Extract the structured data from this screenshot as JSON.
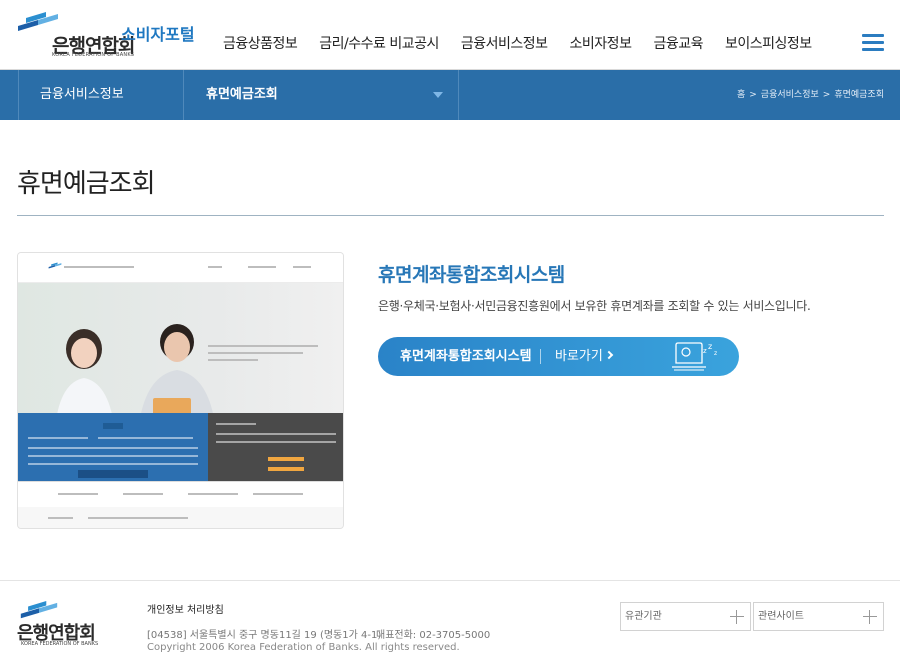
{
  "header": {
    "logo_text": "은행연합회",
    "logo_sub": "KOREA FEDERATION OF BANKS",
    "portal": "소비자포털",
    "nav": [
      "금융상품정보",
      "금리/수수료 비교공시",
      "금융서비스정보",
      "소비자정보",
      "금융교육",
      "보이스피싱정보"
    ],
    "menu_icon": "hamburger-icon"
  },
  "locbar": {
    "section": "금융서비스정보",
    "current": "휴면예금조회",
    "breadcrumb": [
      "홈",
      "금융서비스정보",
      "휴면예금조회"
    ]
  },
  "page": {
    "title": "휴면예금조회"
  },
  "service": {
    "title": "휴면계좌통합조회시스템",
    "description": "은행·우체국·보험사·서민금융진흥원에서 보유한 휴면계좌를 조회할 수 있는 서비스입니다.",
    "button_label": "휴면계좌통합조회시스템",
    "button_go": "바로가기"
  },
  "footer": {
    "logo_text": "은행연합회",
    "logo_sub": "KOREA FEDERATION OF BANKS",
    "privacy": "개인정보 처리방침",
    "address": "[04538] 서울특별시 중구 명동11길 19 (명동1가 4-1)",
    "tel": "대표전화: 02-3705-5000",
    "copyright": "Copyright 2006 Korea Federation of Banks. All rights reserved.",
    "select_related_org": "유관기관",
    "select_related_site": "관련사이트"
  },
  "colors": {
    "brand_blue": "#2a6ea8",
    "accent_blue": "#2777b7",
    "button_gradient_start": "#2a83c8",
    "button_gradient_end": "#3aa3dd"
  }
}
